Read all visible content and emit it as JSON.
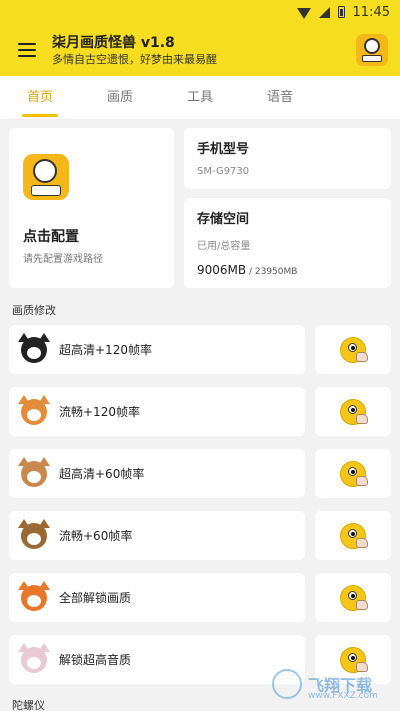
{
  "status_bar": {
    "time": "11:45"
  },
  "app_bar": {
    "title": "柒月画质怪兽 v1.8",
    "subtitle": "多情自古空遗恨，好梦由来最易醒"
  },
  "tabs": [
    {
      "label": "首页",
      "active": true
    },
    {
      "label": "画质",
      "active": false
    },
    {
      "label": "工具",
      "active": false
    },
    {
      "label": "语音",
      "active": false
    }
  ],
  "config_card": {
    "title": "点击配置",
    "subtitle": "请先配置游戏路径"
  },
  "model_card": {
    "title": "手机型号",
    "value": "SM-G9730"
  },
  "storage_card": {
    "title": "存储空间",
    "label": "已用/总容量",
    "used": "9006MB",
    "total": " / 23950MB"
  },
  "sections": {
    "quality": "画质修改",
    "gyro": "陀螺仪"
  },
  "rows": [
    {
      "label": "超高清+120帧率",
      "icon": "tuxedo-cat-icon",
      "color": "#222222"
    },
    {
      "label": "流畅+120帧率",
      "icon": "orange-cat-icon",
      "color": "#e58c3b"
    },
    {
      "label": "超高清+60帧率",
      "icon": "calico-cat-icon",
      "color": "#c8884e"
    },
    {
      "label": "流畅+60帧率",
      "icon": "dog-icon",
      "color": "#9b6a34"
    },
    {
      "label": "全部解锁画质",
      "icon": "fox-icon",
      "color": "#e8772a"
    },
    {
      "label": "解锁超高音质",
      "icon": "white-cat-icon",
      "color": "#e9c9d3"
    }
  ],
  "watermark": {
    "text": "飞翔下载",
    "url": "www.FXXZ.com"
  },
  "colors": {
    "accent": "#f7dd1f",
    "tab_active": "#e0a800",
    "background": "#f2f2f2"
  }
}
